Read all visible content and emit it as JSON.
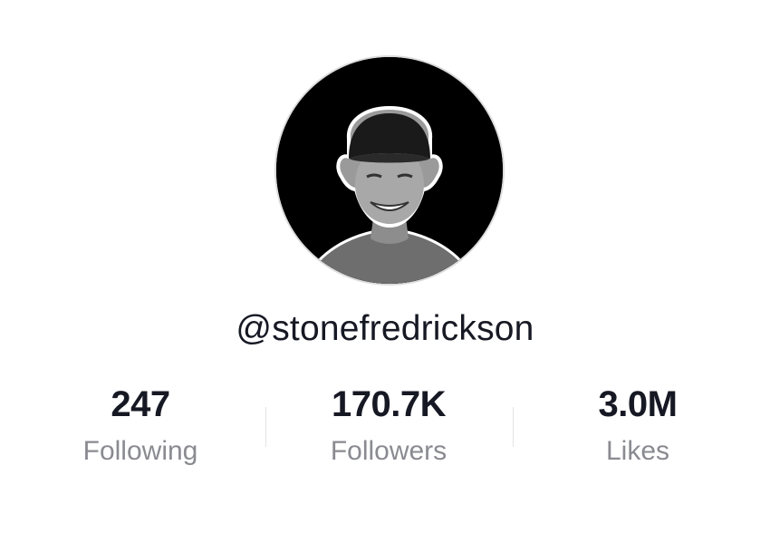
{
  "profile": {
    "username": "@stonefredrickson",
    "avatar": "profile-photo",
    "stats": [
      {
        "value": "247",
        "label": "Following"
      },
      {
        "value": "170.7K",
        "label": "Followers"
      },
      {
        "value": "3.0M",
        "label": "Likes"
      }
    ]
  },
  "colors": {
    "text_primary": "#161823",
    "text_secondary": "#8a8b91",
    "divider": "#e3e3e4",
    "avatar_background": "#000000"
  }
}
